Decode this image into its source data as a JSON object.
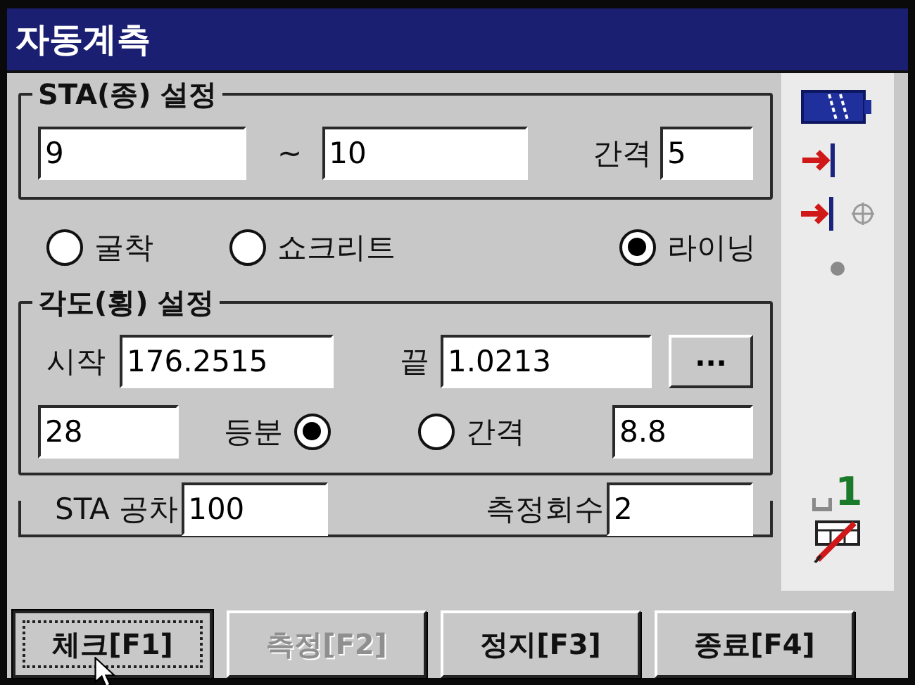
{
  "window": {
    "title": "자동계측"
  },
  "sta_group": {
    "title": "STA(종) 설정",
    "from": "9",
    "separator": "~",
    "to": "10",
    "interval_label": "간격",
    "interval": "5"
  },
  "modes": [
    {
      "label": "굴착",
      "selected": false
    },
    {
      "label": "쇼크리트",
      "selected": false
    },
    {
      "label": "라이닝",
      "selected": true
    }
  ],
  "angle_group": {
    "title": "각도(횡) 설정",
    "start_label": "시작",
    "start": "176.2515",
    "end_label": "끝",
    "end": "1.0213",
    "browse": "...",
    "divisions": "28",
    "options": [
      {
        "label": "등분",
        "kind": "label-first",
        "selected": true
      },
      {
        "label": "간격",
        "kind": "label-after",
        "selected": false
      }
    ],
    "interval": "8.8"
  },
  "tolerance": {
    "label": "STA 공차",
    "value": "100"
  },
  "count": {
    "label": "측정회수",
    "value": "2"
  },
  "buttons": [
    {
      "label": "체크[F1]",
      "disabled": false,
      "focused": true
    },
    {
      "label": "측정[F2]",
      "disabled": true,
      "focused": false
    },
    {
      "label": "정지[F3]",
      "disabled": false,
      "focused": false
    },
    {
      "label": "종료[F4]",
      "disabled": false,
      "focused": false
    }
  ],
  "status": {
    "input_mode": "1"
  }
}
